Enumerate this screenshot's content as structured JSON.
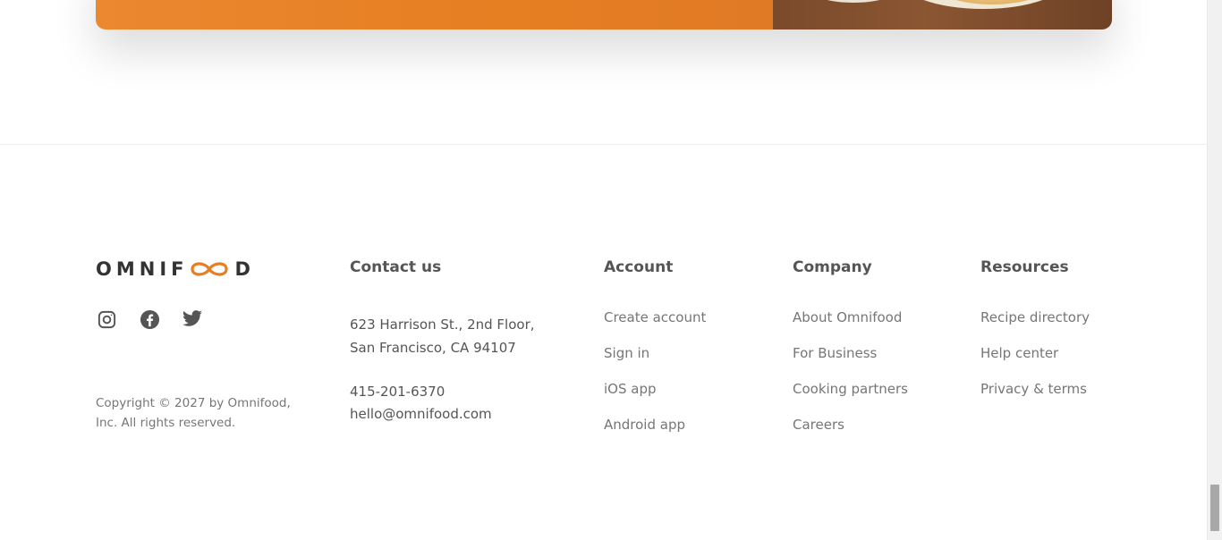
{
  "colors": {
    "brand_orange": "#e67e22",
    "heading": "#555555",
    "link": "#767676",
    "logo_text": "#333333"
  },
  "cta": {
    "image_alt": "food-photo"
  },
  "footer": {
    "logo": {
      "left": "OMNIF",
      "right": "D"
    },
    "socials": [
      {
        "name": "instagram-icon"
      },
      {
        "name": "facebook-icon"
      },
      {
        "name": "twitter-icon"
      }
    ],
    "copyright_line1": "Copyright © 2027 by Omnifood,",
    "copyright_line2": "Inc. All rights reserved.",
    "contact": {
      "title": "Contact us",
      "address_line1": "623 Harrison St., 2nd Floor,",
      "address_line2": "San Francisco, CA 94107",
      "phone": "415-201-6370",
      "email": "hello@omnifood.com"
    },
    "account": {
      "title": "Account",
      "links": [
        "Create account",
        "Sign in",
        "iOS app",
        "Android app"
      ]
    },
    "company": {
      "title": "Company",
      "links": [
        "About Omnifood",
        "For Business",
        "Cooking partners",
        "Careers"
      ]
    },
    "resources": {
      "title": "Resources",
      "links": [
        "Recipe directory",
        "Help center",
        "Privacy & terms"
      ]
    }
  }
}
